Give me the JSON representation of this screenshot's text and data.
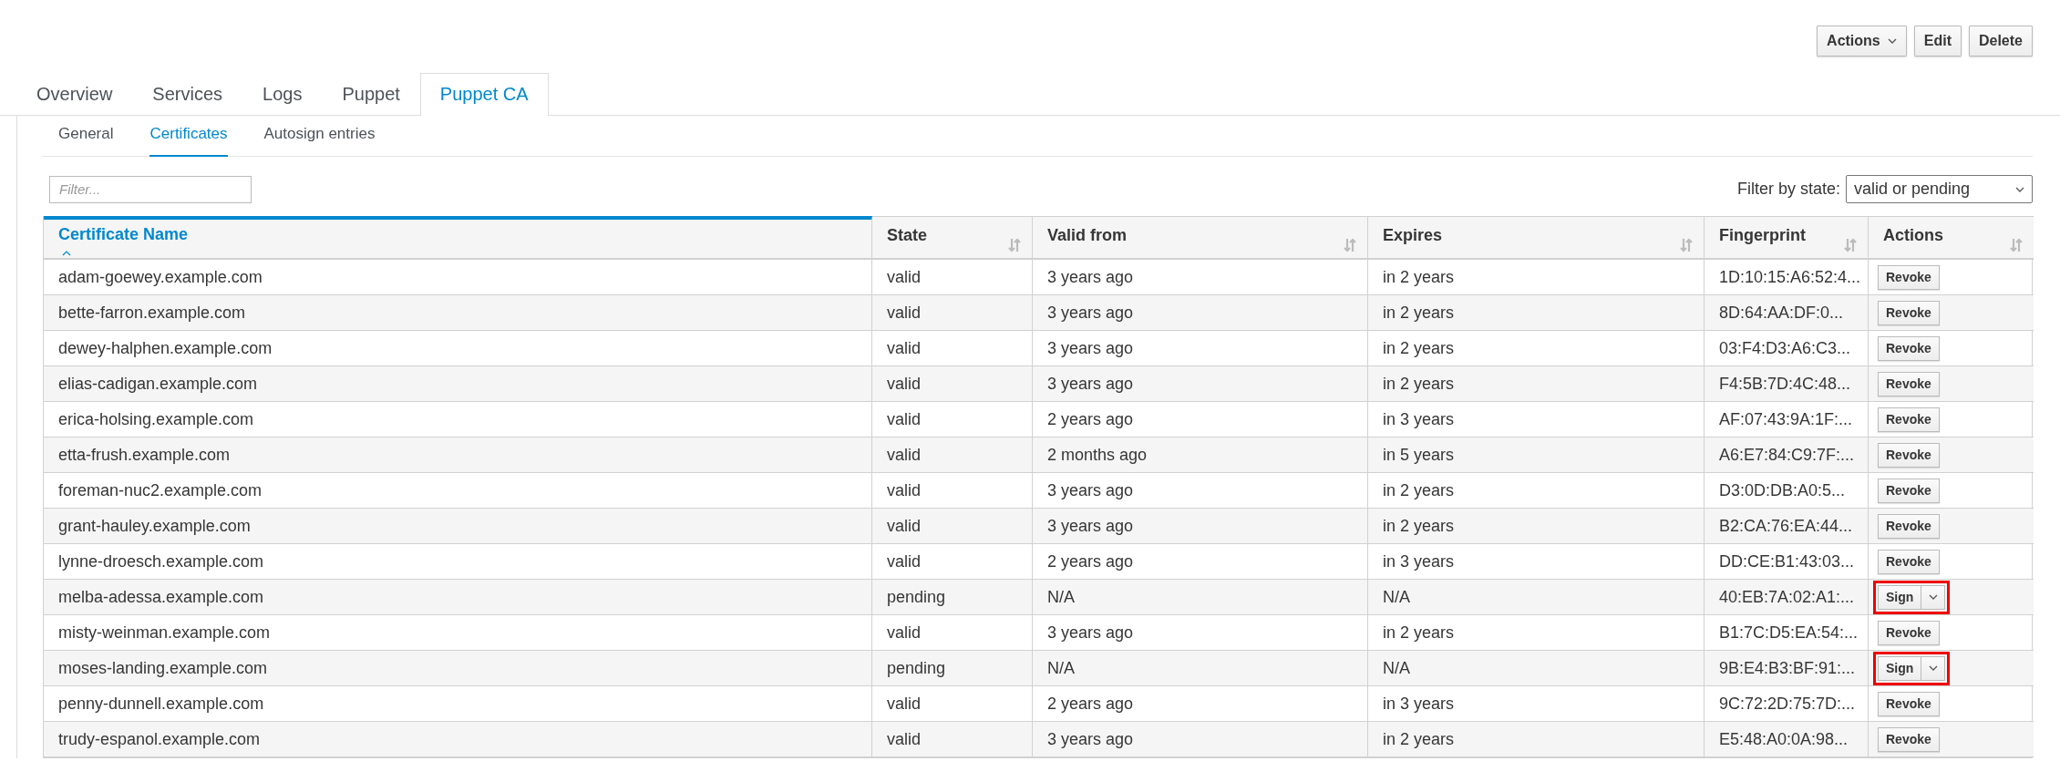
{
  "header_buttons": [
    {
      "label": "Actions",
      "kind": "dropdown"
    },
    {
      "label": "Edit",
      "kind": "plain"
    },
    {
      "label": "Delete",
      "kind": "plain"
    }
  ],
  "tabs": [
    {
      "label": "Overview",
      "selected": false
    },
    {
      "label": "Services",
      "selected": false
    },
    {
      "label": "Logs",
      "selected": false
    },
    {
      "label": "Puppet",
      "selected": false
    },
    {
      "label": "Puppet CA",
      "selected": true
    }
  ],
  "subtabs": [
    {
      "label": "General",
      "selected": false
    },
    {
      "label": "Certificates",
      "selected": true
    },
    {
      "label": "Autosign entries",
      "selected": false
    }
  ],
  "filter": {
    "placeholder": "Filter..."
  },
  "state_filter": {
    "label": "Filter by state:",
    "value": "valid or pending"
  },
  "table": {
    "columns": [
      {
        "label": "Certificate Name",
        "sorted": true
      },
      {
        "label": "State",
        "sorted": false
      },
      {
        "label": "Valid from",
        "sorted": false
      },
      {
        "label": "Expires",
        "sorted": false
      },
      {
        "label": "Fingerprint",
        "sorted": false
      },
      {
        "label": "Actions",
        "sorted": false
      }
    ],
    "rows": [
      {
        "name": "adam-goewey.example.com",
        "state": "valid",
        "valid_from": "3 years ago",
        "expires": "in 2 years",
        "fingerprint": "1D:10:15:A6:52:4...",
        "action": {
          "kind": "revoke",
          "label": "Revoke",
          "highlighted": false
        }
      },
      {
        "name": "bette-farron.example.com",
        "state": "valid",
        "valid_from": "3 years ago",
        "expires": "in 2 years",
        "fingerprint": "8D:64:AA:DF:0...",
        "action": {
          "kind": "revoke",
          "label": "Revoke",
          "highlighted": false
        }
      },
      {
        "name": "dewey-halphen.example.com",
        "state": "valid",
        "valid_from": "3 years ago",
        "expires": "in 2 years",
        "fingerprint": "03:F4:D3:A6:C3...",
        "action": {
          "kind": "revoke",
          "label": "Revoke",
          "highlighted": false
        }
      },
      {
        "name": "elias-cadigan.example.com",
        "state": "valid",
        "valid_from": "3 years ago",
        "expires": "in 2 years",
        "fingerprint": "F4:5B:7D:4C:48...",
        "action": {
          "kind": "revoke",
          "label": "Revoke",
          "highlighted": false
        }
      },
      {
        "name": "erica-holsing.example.com",
        "state": "valid",
        "valid_from": "2 years ago",
        "expires": "in 3 years",
        "fingerprint": "AF:07:43:9A:1F:...",
        "action": {
          "kind": "revoke",
          "label": "Revoke",
          "highlighted": false
        }
      },
      {
        "name": "etta-frush.example.com",
        "state": "valid",
        "valid_from": "2 months ago",
        "expires": "in 5 years",
        "fingerprint": "A6:E7:84:C9:7F:...",
        "action": {
          "kind": "revoke",
          "label": "Revoke",
          "highlighted": false
        }
      },
      {
        "name": "foreman-nuc2.example.com",
        "state": "valid",
        "valid_from": "3 years ago",
        "expires": "in 2 years",
        "fingerprint": "D3:0D:DB:A0:5...",
        "action": {
          "kind": "revoke",
          "label": "Revoke",
          "highlighted": false
        }
      },
      {
        "name": "grant-hauley.example.com",
        "state": "valid",
        "valid_from": "3 years ago",
        "expires": "in 2 years",
        "fingerprint": "B2:CA:76:EA:44...",
        "action": {
          "kind": "revoke",
          "label": "Revoke",
          "highlighted": false
        }
      },
      {
        "name": "lynne-droesch.example.com",
        "state": "valid",
        "valid_from": "2 years ago",
        "expires": "in 3 years",
        "fingerprint": "DD:CE:B1:43:03...",
        "action": {
          "kind": "revoke",
          "label": "Revoke",
          "highlighted": false
        }
      },
      {
        "name": "melba-adessa.example.com",
        "state": "pending",
        "valid_from": "N/A",
        "expires": "N/A",
        "fingerprint": "40:EB:7A:02:A1:...",
        "action": {
          "kind": "sign",
          "label": "Sign",
          "highlighted": true
        }
      },
      {
        "name": "misty-weinman.example.com",
        "state": "valid",
        "valid_from": "3 years ago",
        "expires": "in 2 years",
        "fingerprint": "B1:7C:D5:EA:54:...",
        "action": {
          "kind": "revoke",
          "label": "Revoke",
          "highlighted": false
        }
      },
      {
        "name": "moses-landing.example.com",
        "state": "pending",
        "valid_from": "N/A",
        "expires": "N/A",
        "fingerprint": "9B:E4:B3:BF:91:...",
        "action": {
          "kind": "sign",
          "label": "Sign",
          "highlighted": true
        }
      },
      {
        "name": "penny-dunnell.example.com",
        "state": "valid",
        "valid_from": "2 years ago",
        "expires": "in 3 years",
        "fingerprint": "9C:72:2D:75:7D:...",
        "action": {
          "kind": "revoke",
          "label": "Revoke",
          "highlighted": false
        }
      },
      {
        "name": "trudy-espanol.example.com",
        "state": "valid",
        "valid_from": "3 years ago",
        "expires": "in 2 years",
        "fingerprint": "E5:48:A0:0A:98...",
        "action": {
          "kind": "revoke",
          "label": "Revoke",
          "highlighted": false
        }
      }
    ]
  }
}
